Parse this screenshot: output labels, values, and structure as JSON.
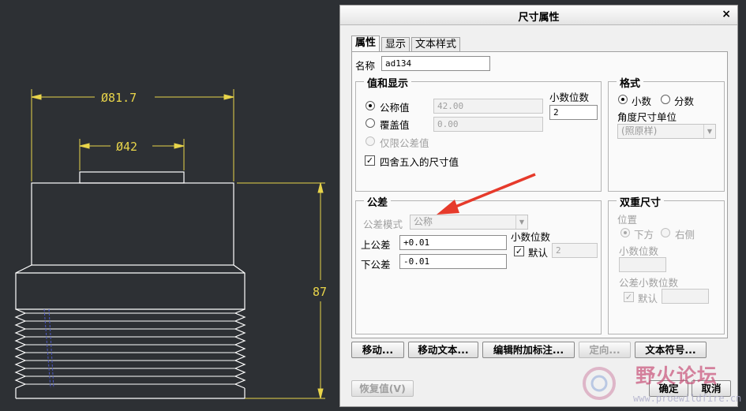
{
  "drawing": {
    "dim_outer": "Ø81.7",
    "dim_inner": "Ø42",
    "dim_height": "87",
    "colors": {
      "dimension": "#e8d44a",
      "outline": "#ffffff",
      "thread": "#4a58c8"
    }
  },
  "dialog": {
    "title": "尺寸属性",
    "close_glyph": "×",
    "tabs": [
      {
        "label": "属性",
        "active": true
      },
      {
        "label": "显示",
        "active": false
      },
      {
        "label": "文本样式",
        "active": false
      }
    ],
    "name": {
      "label": "名称",
      "value": "ad134"
    },
    "value_display": {
      "legend": "值和显示",
      "nominal": {
        "label": "公称值",
        "value": "42.00",
        "selected": true
      },
      "override": {
        "label": "覆盖值",
        "value": "0.00",
        "selected": false
      },
      "tolerance_only": {
        "label": "仅限公差值",
        "selected": false
      },
      "decimals": {
        "label": "小数位数",
        "value": "2"
      },
      "rounded": {
        "label": "四舍五入的尺寸值",
        "checked": true
      }
    },
    "format": {
      "legend": "格式",
      "decimal": {
        "label": "小数",
        "selected": true
      },
      "fraction": {
        "label": "分数",
        "selected": false
      },
      "angle_units_label": "角度尺寸单位",
      "angle_units_value": "(照原样)"
    },
    "tolerance": {
      "legend": "公差",
      "mode_label": "公差模式",
      "mode_value": "公称",
      "upper": {
        "label": "上公差",
        "value": "+0.01"
      },
      "lower": {
        "label": "下公差",
        "value": "-0.01"
      },
      "decimals_label": "小数位数",
      "default": {
        "label": "默认",
        "checked": true,
        "value": "2"
      }
    },
    "dual": {
      "legend": "双重尺寸",
      "position_label": "位置",
      "below": {
        "label": "下方",
        "selected": true
      },
      "right": {
        "label": "右侧",
        "selected": false
      },
      "decimals_label": "小数位数",
      "tol_decimals_label": "公差小数位数",
      "default": {
        "label": "默认",
        "checked": true
      }
    },
    "buttons": {
      "move": "移动...",
      "move_text": "移动文本...",
      "edit_note": "编辑附加标注...",
      "orient": "定向...",
      "text_symbol": "文本符号...",
      "restore": "恢复值(V)",
      "ok": "确定",
      "cancel": "取消"
    }
  },
  "watermark": {
    "title": "野火论坛",
    "url": "www.proewildfire.cn"
  }
}
